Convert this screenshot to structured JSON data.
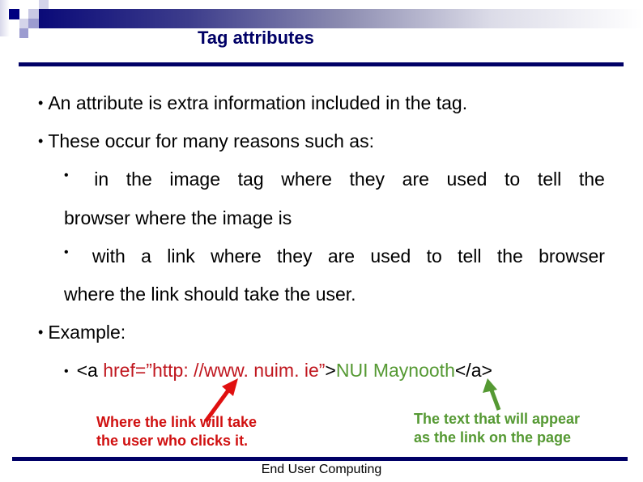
{
  "slide": {
    "title": "Tag attributes",
    "footer": "End User Computing",
    "colors": {
      "title": "#000066",
      "rule": "#000066",
      "attribute": "#c0171f",
      "link_text": "#559933"
    },
    "bullets": [
      {
        "text": "An attribute is extra information included in the tag."
      },
      {
        "text": "These occur for many reasons such as:"
      },
      {
        "text": "Example:"
      }
    ],
    "sub_bullets": [
      {
        "line1_words": [
          "in",
          "the",
          "image",
          "tag",
          "where",
          "they",
          "are",
          "used",
          "to",
          "tell",
          "the"
        ],
        "line2": "browser where the image is"
      },
      {
        "line1_words": [
          "with",
          "a",
          "link",
          "where",
          "they",
          "are",
          "used",
          "to",
          "tell",
          "the",
          "browser"
        ],
        "line2": "where the link should take the user."
      }
    ],
    "example": {
      "open": "<a ",
      "attribute": "href=”http: //www. nuim. ie”",
      "gt": ">",
      "link_text": "NUI Maynooth",
      "close": "</a>"
    },
    "annotations": {
      "attribute_note": [
        "Where the link will take",
        "the user who clicks it."
      ],
      "link_text_note": [
        "The text that will appear",
        "as the link on the page"
      ]
    }
  }
}
